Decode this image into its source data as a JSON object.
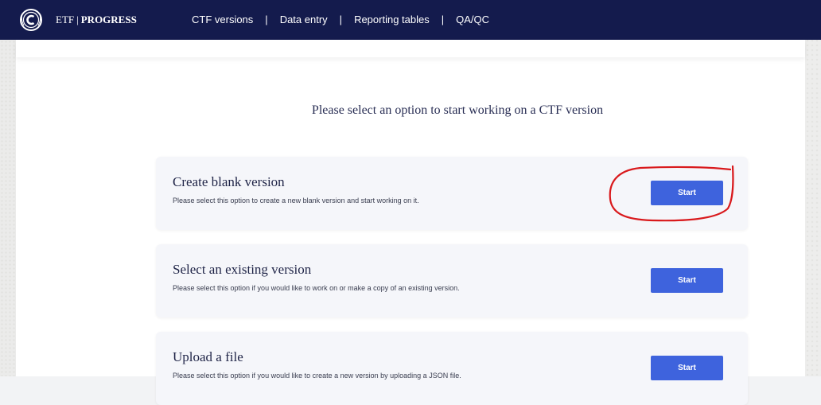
{
  "navbar": {
    "brand_prefix": "ETF",
    "brand_name": "PROGRESS",
    "links": [
      {
        "label": "CTF versions"
      },
      {
        "label": "Data entry"
      },
      {
        "label": "Reporting tables"
      },
      {
        "label": "QA/QC"
      }
    ],
    "separator": "|",
    "background": "#141b4d"
  },
  "main": {
    "title": "Please select an option to start working on a CTF version",
    "options": [
      {
        "title": "Create blank version",
        "description": "Please select this option to create a new blank version and start working on it.",
        "button_label": "Start"
      },
      {
        "title": "Select an existing version",
        "description": "Please select this option if you would like to work on or make a copy of an existing version.",
        "button_label": "Start"
      },
      {
        "title": "Upload a file",
        "description": "Please select this option if you would like to create a new version by uploading a JSON file.",
        "button_label": "Start"
      }
    ]
  },
  "colors": {
    "button": "#3e63dd",
    "annotation": "#d9191c",
    "card": "#f5f6fa"
  },
  "icons": {
    "logo": "un-emblem-icon"
  }
}
